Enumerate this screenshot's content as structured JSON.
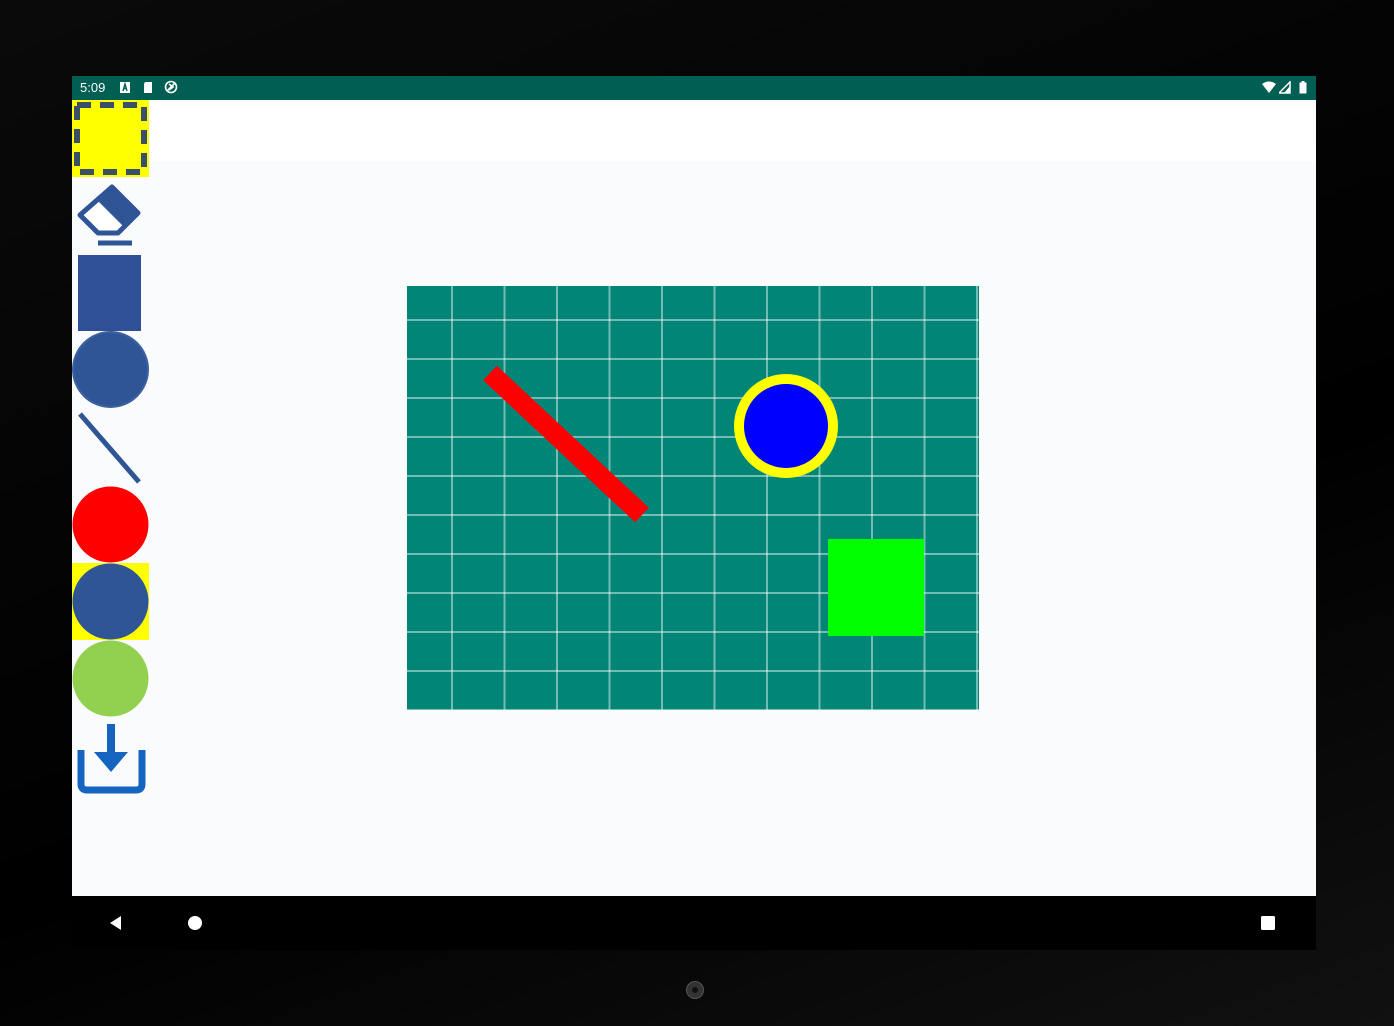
{
  "status_bar": {
    "time": "5:09",
    "left_icons": [
      "a-notification-icon",
      "sd-card-icon",
      "sync-icon"
    ],
    "right_icons": [
      "wifi-icon",
      "signal-icon",
      "battery-icon"
    ],
    "background": "#005f52"
  },
  "toolbar": {
    "tools": [
      {
        "name": "select-tool",
        "icon": "dashed-selection-icon",
        "selected": true
      },
      {
        "name": "eraser-tool",
        "icon": "eraser-icon",
        "selected": false
      },
      {
        "name": "rectangle-tool",
        "icon": "square-icon",
        "selected": false
      },
      {
        "name": "circle-tool",
        "icon": "circle-icon",
        "selected": false
      },
      {
        "name": "line-tool",
        "icon": "line-icon",
        "selected": false
      },
      {
        "name": "color-red",
        "icon": "color-swatch",
        "color": "#ff0000",
        "selected": false
      },
      {
        "name": "color-blue",
        "icon": "color-swatch",
        "color": "#2f5597",
        "selected": true
      },
      {
        "name": "color-green",
        "icon": "color-swatch",
        "color": "#92d050",
        "selected": false
      },
      {
        "name": "save-tool",
        "icon": "download-icon",
        "selected": false
      }
    ],
    "accent_color": "#2f5597",
    "selected_highlight": "#ffff00"
  },
  "canvas": {
    "background": "#008577",
    "grid_color": "rgba(255,255,255,0.45)",
    "shapes": [
      {
        "type": "line",
        "color": "#ff0000"
      },
      {
        "type": "circle",
        "fill": "#0000ff",
        "stroke": "#ffff00"
      },
      {
        "type": "rectangle",
        "fill": "#00ff00"
      }
    ]
  },
  "nav_bar": {
    "buttons": [
      "back-icon",
      "home-icon",
      "recents-icon"
    ]
  }
}
